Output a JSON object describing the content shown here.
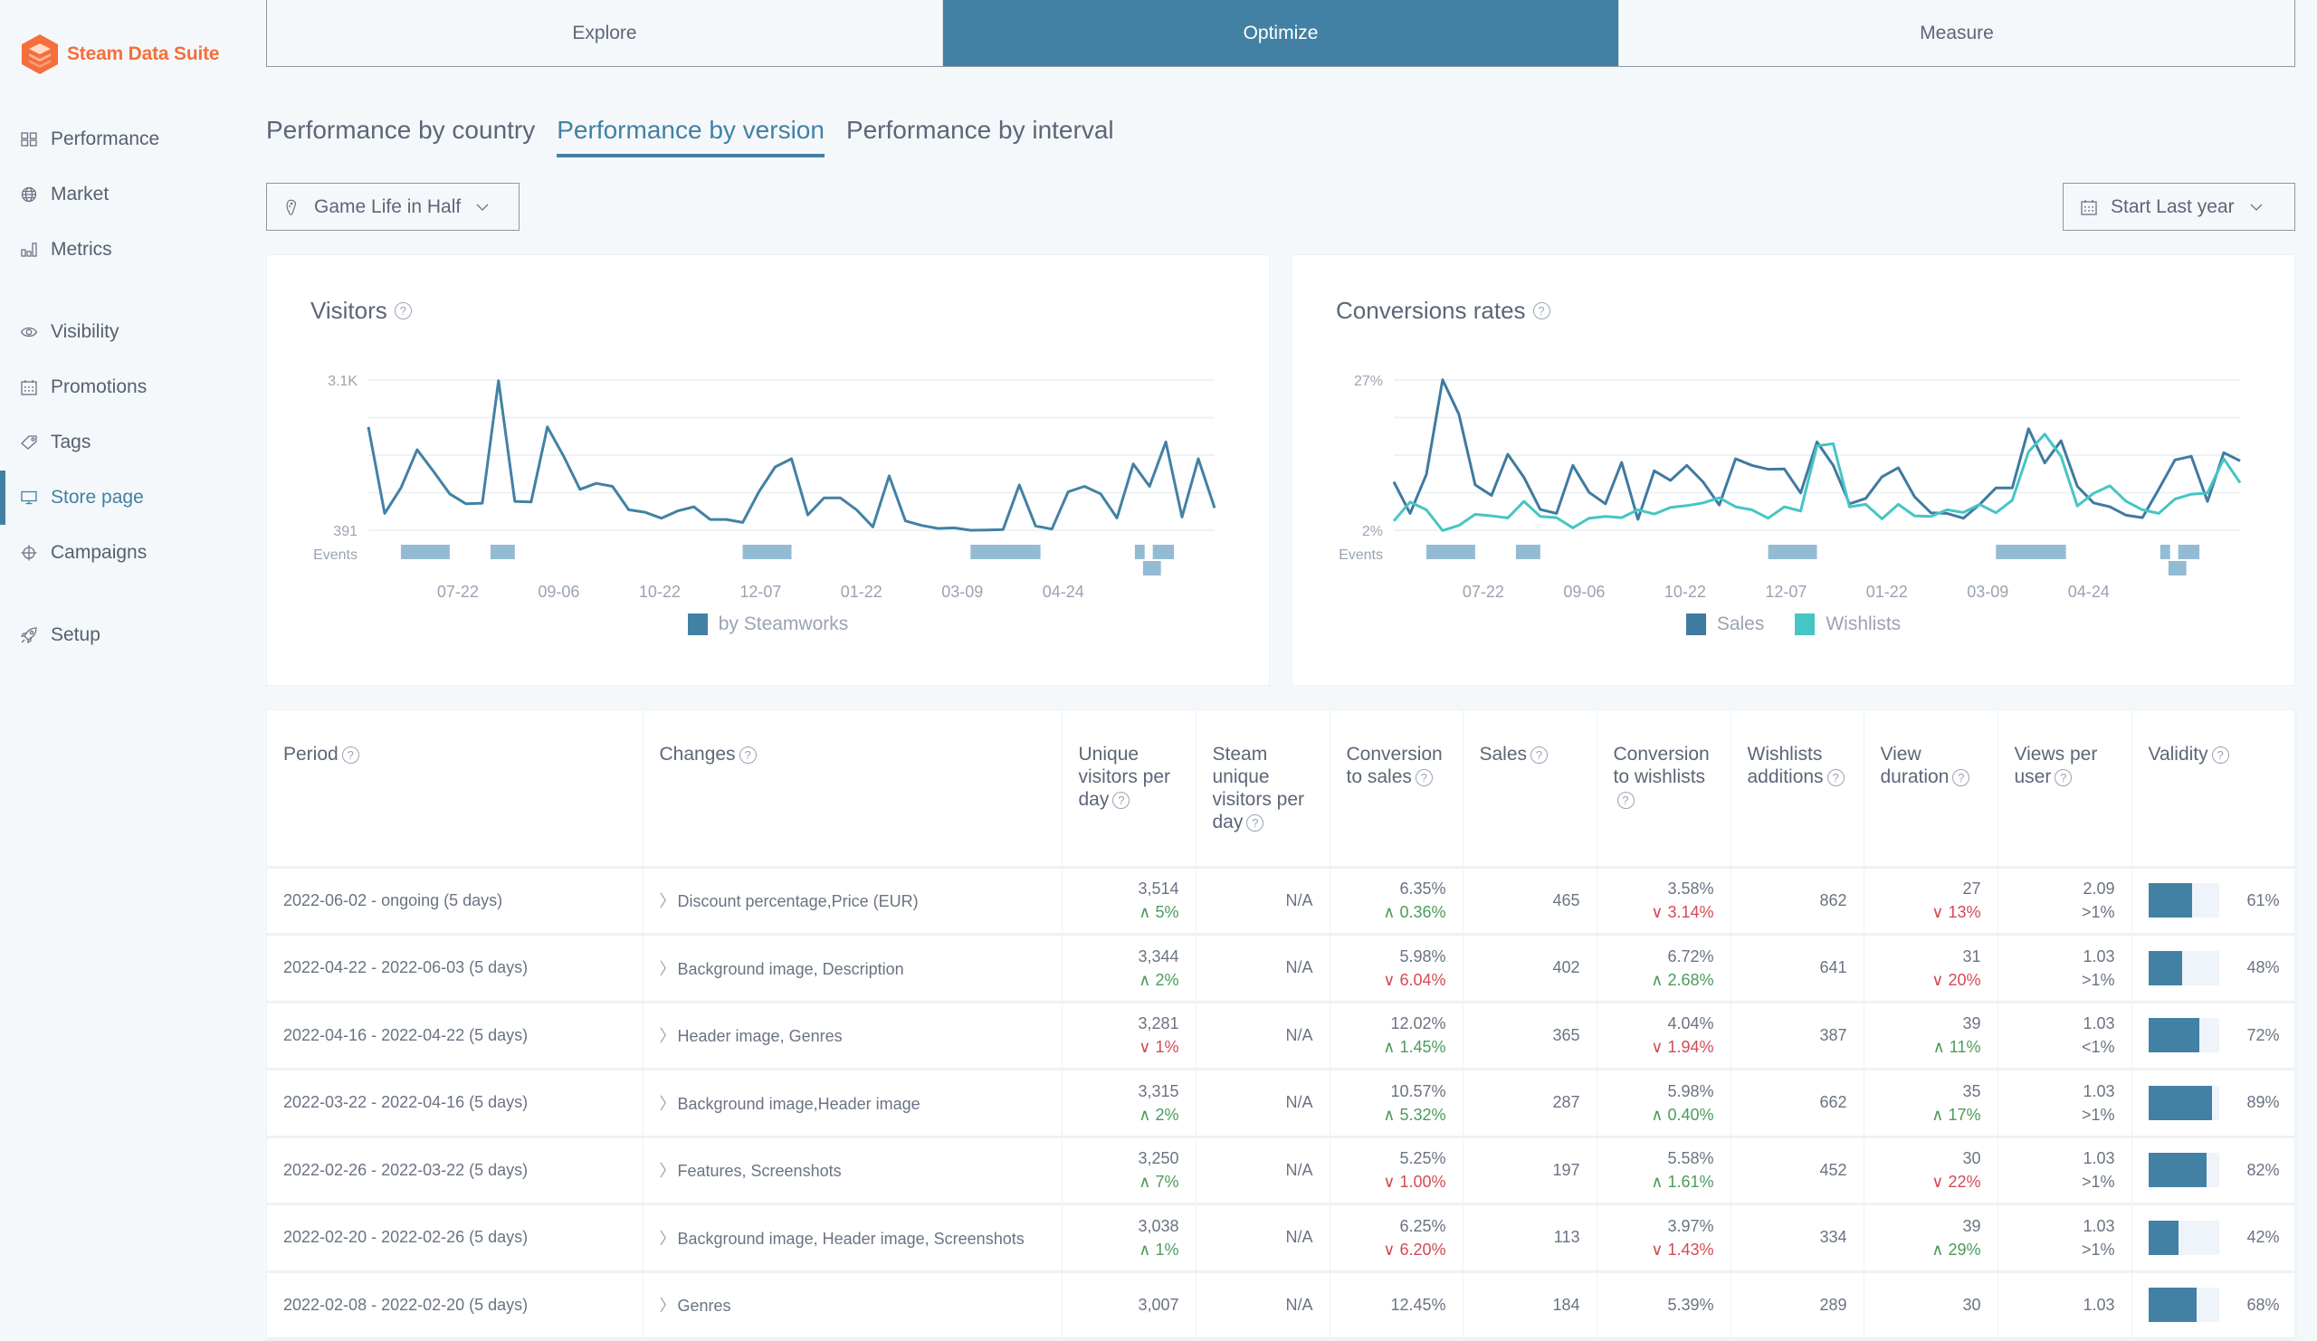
{
  "app": {
    "name": "Steam Data Suite",
    "brand_color": "#f46f3c",
    "accent_color": "#4281a4"
  },
  "sidebar": {
    "items": [
      {
        "label": "Performance",
        "icon": "grid-icon",
        "active": false
      },
      {
        "label": "Market",
        "icon": "globe-icon",
        "active": false
      },
      {
        "label": "Metrics",
        "icon": "bar-chart-icon",
        "active": false
      },
      {
        "label": "Visibility",
        "icon": "eye-icon",
        "active": false
      },
      {
        "label": "Promotions",
        "icon": "calendar-icon",
        "active": false
      },
      {
        "label": "Tags",
        "icon": "tag-icon",
        "active": false
      },
      {
        "label": "Store page",
        "icon": "monitor-icon",
        "active": true
      },
      {
        "label": "Campaigns",
        "icon": "crosshair-icon",
        "active": false
      },
      {
        "label": "Setup",
        "icon": "rocket-icon",
        "active": false
      }
    ]
  },
  "top_tabs": [
    {
      "label": "Explore",
      "active": false
    },
    {
      "label": "Optimize",
      "active": true
    },
    {
      "label": "Measure",
      "active": false
    }
  ],
  "sub_tabs": [
    {
      "label": "Performance by country",
      "active": false
    },
    {
      "label": "Performance by version",
      "active": true
    },
    {
      "label": "Performance by interval",
      "active": false
    }
  ],
  "game_select": {
    "value": "Game Life in Half",
    "icon": "gamepad-icon"
  },
  "date_select": {
    "value": "Start Last year",
    "icon": "calendar-icon"
  },
  "chart_data": [
    {
      "type": "line",
      "title": "Visitors",
      "y_tick_labels": [
        "3.1K",
        "391"
      ],
      "ylim": [
        391,
        3100
      ],
      "x_tick_labels": [
        "07-22",
        "09-06",
        "10-22",
        "12-07",
        "01-22",
        "03-09",
        "04-24"
      ],
      "x_tick_positions": [
        5.5,
        11.7,
        17.9,
        24.1,
        30.3,
        36.5,
        42.7
      ],
      "events_label": "Events",
      "events": [
        {
          "start": 2,
          "end": 5,
          "lane": 0
        },
        {
          "start": 7.5,
          "end": 9,
          "lane": 0
        },
        {
          "start": 23,
          "end": 26,
          "lane": 0
        },
        {
          "start": 37,
          "end": 41.3,
          "lane": 0
        },
        {
          "start": 47.1,
          "end": 47.7,
          "lane": 0
        },
        {
          "start": 48.2,
          "end": 49.5,
          "lane": 0
        },
        {
          "start": 47.6,
          "end": 48.7,
          "lane": 1
        }
      ],
      "series": [
        {
          "name": "by Steamworks",
          "color": "#4281a4",
          "values": [
            2255,
            694,
            1155,
            1843,
            1453,
            1047,
            868,
            879,
            3089,
            911,
            900,
            2255,
            1724,
            1128,
            1236,
            1182,
            759,
            716,
            608,
            738,
            814,
            586,
            586,
            532,
            1085,
            1534,
            1680,
            667,
            976,
            976,
            759,
            451,
            1372,
            559,
            478,
            424,
            434,
            391,
            396,
            402,
            1209,
            467,
            413,
            1085,
            1182,
            1047,
            613,
            1588,
            1182,
            1984,
            629,
            1680,
            792
          ]
        }
      ]
    },
    {
      "type": "line",
      "title": "Conversions rates",
      "y_tick_labels": [
        "27%",
        "2%"
      ],
      "ylim": [
        2,
        27
      ],
      "x_tick_labels": [
        "07-22",
        "09-06",
        "10-22",
        "12-07",
        "01-22",
        "03-09",
        "04-24"
      ],
      "x_tick_positions": [
        5.5,
        11.7,
        17.9,
        24.1,
        30.3,
        36.5,
        42.7
      ],
      "events_label": "Events",
      "events": [
        {
          "start": 2,
          "end": 5,
          "lane": 0
        },
        {
          "start": 7.5,
          "end": 9,
          "lane": 0
        },
        {
          "start": 23,
          "end": 26,
          "lane": 0
        },
        {
          "start": 37,
          "end": 41.3,
          "lane": 0
        },
        {
          "start": 47.1,
          "end": 47.7,
          "lane": 0
        },
        {
          "start": 48.2,
          "end": 49.5,
          "lane": 0
        },
        {
          "start": 47.6,
          "end": 48.7,
          "lane": 1
        }
      ],
      "series": [
        {
          "name": "Sales",
          "color": "#3f7aa0",
          "values": [
            10.05,
            4.8,
            11.3,
            27.05,
            21.3,
            9.55,
            7.8,
            14.65,
            10.8,
            5.45,
            4.8,
            12.8,
            8.3,
            6.4,
            13.3,
            3.8,
            11.9,
            10.3,
            12.8,
            10.05,
            6.2,
            13.9,
            12.8,
            12.15,
            12.2,
            8.2,
            16.7,
            12.8,
            6.4,
            7.3,
            10.9,
            12.4,
            7.55,
            4.9,
            4.8,
            4.0,
            6.3,
            9.05,
            9.05,
            18.9,
            13.2,
            16.9,
            9.3,
            6.55,
            5.9,
            4.5,
            4.1,
            8.8,
            13.7,
            14.3,
            6.8,
            14.9,
            13.55
          ]
        },
        {
          "name": "Wishlists",
          "color": "#45c5c4",
          "values": [
            3.55,
            6.7,
            5.4,
            1.95,
            2.8,
            4.65,
            4.4,
            4.05,
            6.8,
            4.3,
            4.1,
            2.4,
            4.0,
            4.3,
            4.1,
            5.4,
            4.7,
            5.8,
            6.1,
            6.55,
            7.4,
            5.9,
            5.4,
            4.0,
            5.9,
            5.2,
            16.05,
            16.4,
            5.9,
            6.3,
            3.9,
            6.3,
            4.4,
            4.3,
            5.4,
            4.95,
            6.3,
            4.9,
            7.0,
            15.05,
            18.0,
            14.3,
            6.05,
            8.15,
            9.4,
            6.8,
            5.4,
            4.8,
            7.2,
            8.0,
            8.2,
            13.9,
            9.9
          ]
        }
      ]
    }
  ],
  "table": {
    "columns": [
      "Period",
      "Changes",
      "Unique visitors per day",
      "Steam unique visitors per day",
      "Conversion to sales",
      "Sales",
      "Conversion to wishlists",
      "Wishlists additions",
      "View duration",
      "Views per user",
      "Validity"
    ],
    "rows": [
      {
        "period": "2022-06-02 - ongoing (5 days)",
        "changes": "Discount percentage,Price (EUR)",
        "uv": "3,514",
        "uv_delta": "5%",
        "uv_dir": "up",
        "suv": "N/A",
        "cs": "6.35%",
        "cs_delta": "0.36%",
        "cs_dir": "up",
        "sales": "465",
        "cw": "3.58%",
        "cw_delta": "3.14%",
        "cw_dir": "down",
        "wa": "862",
        "vd": "27",
        "vd_delta": "13%",
        "vd_dir": "down",
        "vpu": "2.09",
        "vpu_sub": ">1%",
        "validity": "61%",
        "validity_frac": 0.61
      },
      {
        "period": "2022-04-22 - 2022-06-03 (5 days)",
        "changes": "Background image, Description",
        "uv": "3,344",
        "uv_delta": "2%",
        "uv_dir": "up",
        "suv": "N/A",
        "cs": "5.98%",
        "cs_delta": "6.04%",
        "cs_dir": "down",
        "sales": "402",
        "cw": "6.72%",
        "cw_delta": "2.68%",
        "cw_dir": "up",
        "wa": "641",
        "vd": "31",
        "vd_delta": "20%",
        "vd_dir": "down",
        "vpu": "1.03",
        "vpu_sub": ">1%",
        "validity": "48%",
        "validity_frac": 0.48
      },
      {
        "period": "2022-04-16 - 2022-04-22 (5 days)",
        "changes": "Header image, Genres",
        "uv": "3,281",
        "uv_delta": "1%",
        "uv_dir": "down",
        "suv": "N/A",
        "cs": "12.02%",
        "cs_delta": "1.45%",
        "cs_dir": "up",
        "sales": "365",
        "cw": "4.04%",
        "cw_delta": "1.94%",
        "cw_dir": "down",
        "wa": "387",
        "vd": "39",
        "vd_delta": "11%",
        "vd_dir": "up",
        "vpu": "1.03",
        "vpu_sub": "<1%",
        "validity": "72%",
        "validity_frac": 0.72
      },
      {
        "period": "2022-03-22 - 2022-04-16 (5 days)",
        "changes": "Background image,Header image",
        "uv": "3,315",
        "uv_delta": "2%",
        "uv_dir": "up",
        "suv": "N/A",
        "cs": "10.57%",
        "cs_delta": "5.32%",
        "cs_dir": "up",
        "sales": "287",
        "cw": "5.98%",
        "cw_delta": "0.40%",
        "cw_dir": "up",
        "wa": "662",
        "vd": "35",
        "vd_delta": "17%",
        "vd_dir": "up",
        "vpu": "1.03",
        "vpu_sub": ">1%",
        "validity": "89%",
        "validity_frac": 0.89
      },
      {
        "period": "2022-02-26 - 2022-03-22 (5 days)",
        "changes": "Features, Screenshots",
        "uv": "3,250",
        "uv_delta": "7%",
        "uv_dir": "up",
        "suv": "N/A",
        "cs": "5.25%",
        "cs_delta": "1.00%",
        "cs_dir": "down",
        "sales": "197",
        "cw": "5.58%",
        "cw_delta": "1.61%",
        "cw_dir": "up",
        "wa": "452",
        "vd": "30",
        "vd_delta": "22%",
        "vd_dir": "down",
        "vpu": "1.03",
        "vpu_sub": ">1%",
        "validity": "82%",
        "validity_frac": 0.82
      },
      {
        "period": "2022-02-20 - 2022-02-26 (5 days)",
        "changes": "Background image, Header image, Screenshots",
        "uv": "3,038",
        "uv_delta": "1%",
        "uv_dir": "up",
        "suv": "N/A",
        "cs": "6.25%",
        "cs_delta": "6.20%",
        "cs_dir": "down",
        "sales": "113",
        "cw": "3.97%",
        "cw_delta": "1.43%",
        "cw_dir": "down",
        "wa": "334",
        "vd": "39",
        "vd_delta": "29%",
        "vd_dir": "up",
        "vpu": "1.03",
        "vpu_sub": ">1%",
        "validity": "42%",
        "validity_frac": 0.42
      },
      {
        "period": "2022-02-08 - 2022-02-20 (5 days)",
        "changes": "Genres",
        "uv": "3,007",
        "uv_delta": "",
        "uv_dir": "up",
        "suv": "N/A",
        "cs": "12.45%",
        "cs_delta": "",
        "cs_dir": "up",
        "sales": "184",
        "cw": "5.39%",
        "cw_delta": "",
        "cw_dir": "up",
        "wa": "289",
        "vd": "30",
        "vd_delta": "",
        "vd_dir": "up",
        "vpu": "1.03",
        "vpu_sub": "",
        "validity": "68%",
        "validity_frac": 0.68
      }
    ]
  }
}
